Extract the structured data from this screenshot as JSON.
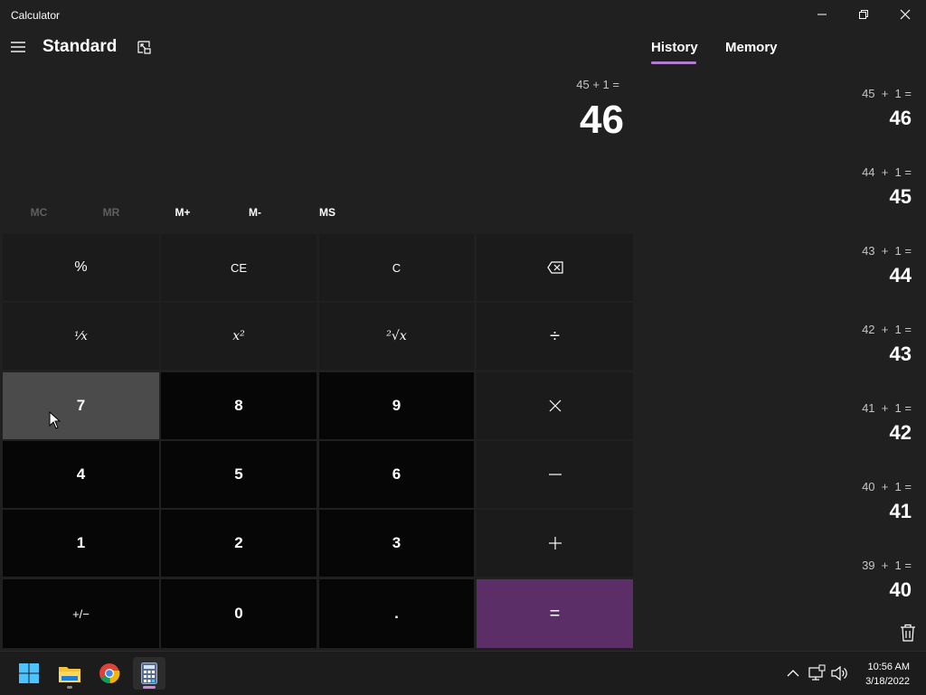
{
  "window": {
    "title": "Calculator"
  },
  "header": {
    "mode": "Standard"
  },
  "display": {
    "expression": "45 + 1 =",
    "result": "46"
  },
  "memory_buttons": [
    {
      "label": "MC",
      "enabled": false
    },
    {
      "label": "MR",
      "enabled": false
    },
    {
      "label": "M+",
      "enabled": true
    },
    {
      "label": "M-",
      "enabled": true
    },
    {
      "label": "MS",
      "enabled": true
    }
  ],
  "keys": {
    "percent": "%",
    "clear_entry": "CE",
    "clear": "C",
    "seven": "7",
    "eight": "8",
    "nine": "9",
    "four": "4",
    "five": "5",
    "six": "6",
    "one": "1",
    "two": "2",
    "three": "3",
    "negate": "+/−",
    "zero": "0",
    "decimal": ".",
    "equals": "="
  },
  "tabs": {
    "history": "History",
    "memory": "Memory"
  },
  "history": [
    {
      "expression": "45  +  1 =",
      "result": "46"
    },
    {
      "expression": "44  +  1 =",
      "result": "45"
    },
    {
      "expression": "43  +  1 =",
      "result": "44"
    },
    {
      "expression": "42  +  1 =",
      "result": "43"
    },
    {
      "expression": "41  +  1 =",
      "result": "42"
    },
    {
      "expression": "40  +  1 =",
      "result": "41"
    },
    {
      "expression": "39  +  1 =",
      "result": "40"
    }
  ],
  "taskbar": {
    "time": "10:56 AM",
    "date": "3/18/2022"
  },
  "colors": {
    "accent": "#b57dd1",
    "equals_key": "#5c2e68",
    "background": "#202020"
  }
}
